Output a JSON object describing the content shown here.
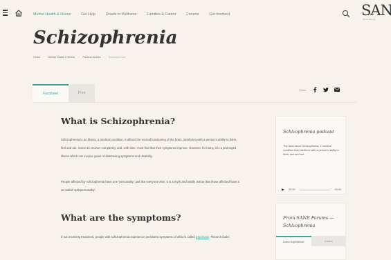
{
  "nav": {
    "links": [
      {
        "label": "Mental Health & Illness",
        "active": true
      },
      {
        "label": "Get Help",
        "active": false
      },
      {
        "label": "Roads to Wellness",
        "active": false
      },
      {
        "label": "Families & Carers",
        "active": false
      },
      {
        "label": "Forums",
        "active": false
      },
      {
        "label": "Get Involved",
        "active": false
      }
    ],
    "logo": "SANE",
    "logo_sub": "AUSTRALIA"
  },
  "page": {
    "title": "Schizophrenia",
    "breadcrumb": [
      "Home",
      "Mental Health & Illness",
      "Facts & Guides",
      "Schizophrenia"
    ]
  },
  "tabs": {
    "factsheet": "Factsheet",
    "print": "Print"
  },
  "share": {
    "label": "Share"
  },
  "article": {
    "h_what": "What is Schizophrenia?",
    "p1": "Schizophrenia is an illness, a medical condition. It affects the normal functioning of the brain, interfering with a person's ability to think, feel and act. Some do recover completely, and, with time, most find that their symptoms improve. However, for many, it is a prolonged illness which can involve years of distressing symptoms and disability.",
    "p2": "People affected by schizophrenia have one 'personality,' just like everyone else. It is a myth and totally untrue that those affected have a so-called 'split personality'.",
    "h_symptoms": "What are the symptoms?",
    "p3_start": "If not receiving treatment, people with schizophrenia experience persistent symptoms of what is called ",
    "p3_link": "psychosis",
    "p3_end": ". These include:"
  },
  "podcast": {
    "title": "Schizophrenia podcast",
    "text": "The facts about Schizophrenia, a medical condition that interferes with a person's ability to think, feel and act.",
    "time_start": "00:00",
    "time_end": "00:00"
  },
  "forums": {
    "title": "From SANE Forums — Schizophrenia",
    "tab_lived": "Lived Experience",
    "tab_carers": "Carers"
  },
  "colors": {
    "accent": "#3aa59a",
    "background": "#f7f3ec"
  }
}
